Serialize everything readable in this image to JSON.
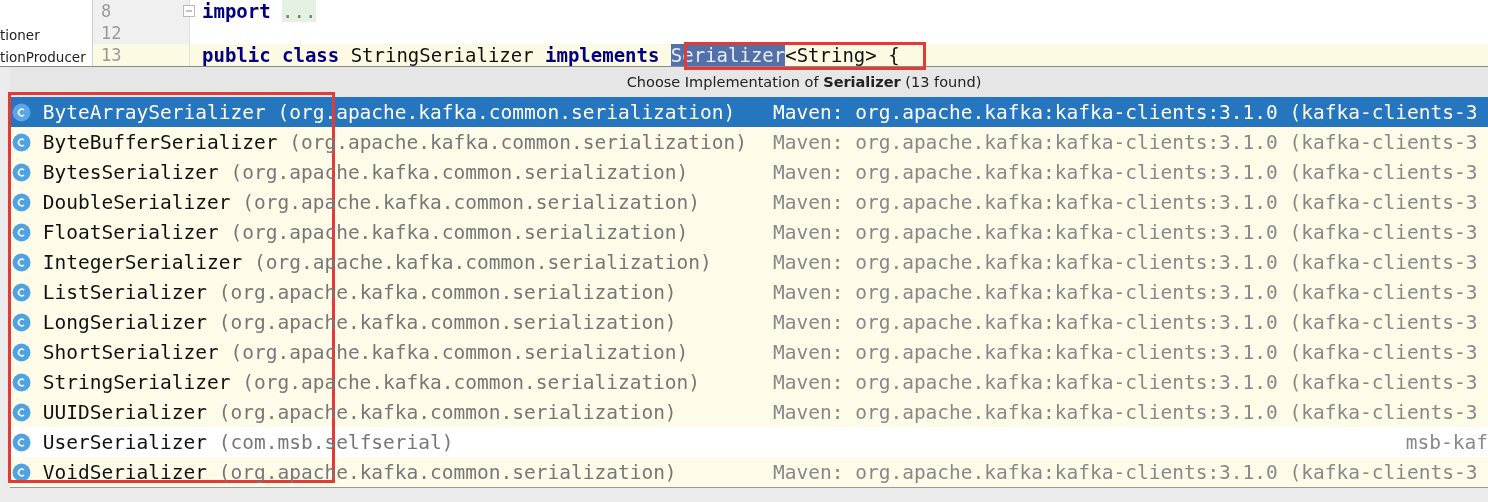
{
  "project_panel": {
    "items": [
      "tioner",
      "tionProducer"
    ]
  },
  "editor": {
    "lines": [
      {
        "number": "8",
        "current": false,
        "foldable": true,
        "tokens": [
          {
            "text": "import",
            "kind": "keyword"
          },
          {
            "text": "...",
            "kind": "folded"
          }
        ]
      },
      {
        "number": "12",
        "current": false,
        "foldable": false
      },
      {
        "number": "13",
        "current": true,
        "foldable": false,
        "tokens": [
          {
            "text": "public",
            "kind": "keyword"
          },
          {
            "text": "class",
            "kind": "keyword"
          },
          {
            "text": "StringSerializer",
            "kind": "plain"
          },
          {
            "text": "implements",
            "kind": "keyword"
          },
          {
            "text": "Serializer",
            "kind": "selected"
          },
          {
            "text": "<String> {",
            "kind": "plain",
            "attached": true
          }
        ]
      }
    ]
  },
  "popup": {
    "title": "Choose Implementation of **Serializer** (13 found)",
    "items": [
      {
        "name": "ByteArraySerializer",
        "package": "(org.apache.kafka.common.serialization)",
        "location": "Maven: org.apache.kafka:kafka-clients:3.1.0 (kafka-clients-3",
        "kind": "library",
        "selected": true
      },
      {
        "name": "ByteBufferSerializer",
        "package": "(org.apache.kafka.common.serialization)",
        "location": "Maven: org.apache.kafka:kafka-clients:3.1.0 (kafka-clients-3",
        "kind": "library",
        "selected": false
      },
      {
        "name": "BytesSerializer",
        "package": "(org.apache.kafka.common.serialization)",
        "location": "Maven: org.apache.kafka:kafka-clients:3.1.0 (kafka-clients-3",
        "kind": "library",
        "selected": false
      },
      {
        "name": "DoubleSerializer",
        "package": "(org.apache.kafka.common.serialization)",
        "location": "Maven: org.apache.kafka:kafka-clients:3.1.0 (kafka-clients-3",
        "kind": "library",
        "selected": false
      },
      {
        "name": "FloatSerializer",
        "package": "(org.apache.kafka.common.serialization)",
        "location": "Maven: org.apache.kafka:kafka-clients:3.1.0 (kafka-clients-3",
        "kind": "library",
        "selected": false
      },
      {
        "name": "IntegerSerializer",
        "package": "(org.apache.kafka.common.serialization)",
        "location": "Maven: org.apache.kafka:kafka-clients:3.1.0 (kafka-clients-3",
        "kind": "library",
        "selected": false
      },
      {
        "name": "ListSerializer",
        "package": "(org.apache.kafka.common.serialization)",
        "location": "Maven: org.apache.kafka:kafka-clients:3.1.0 (kafka-clients-3",
        "kind": "library",
        "selected": false
      },
      {
        "name": "LongSerializer",
        "package": "(org.apache.kafka.common.serialization)",
        "location": "Maven: org.apache.kafka:kafka-clients:3.1.0 (kafka-clients-3",
        "kind": "library",
        "selected": false
      },
      {
        "name": "ShortSerializer",
        "package": "(org.apache.kafka.common.serialization)",
        "location": "Maven: org.apache.kafka:kafka-clients:3.1.0 (kafka-clients-3",
        "kind": "library",
        "selected": false
      },
      {
        "name": "StringSerializer",
        "package": "(org.apache.kafka.common.serialization)",
        "location": "Maven: org.apache.kafka:kafka-clients:3.1.0 (kafka-clients-3",
        "kind": "library",
        "selected": false
      },
      {
        "name": "UUIDSerializer",
        "package": "(org.apache.kafka.common.serialization)",
        "location": "Maven: org.apache.kafka:kafka-clients:3.1.0 (kafka-clients-3",
        "kind": "library",
        "selected": false
      },
      {
        "name": "UserSerializer",
        "package": "(com.msb.selfserial)",
        "location": "msb-kaf",
        "kind": "project",
        "selected": false
      },
      {
        "name": "VoidSerializer",
        "package": "(org.apache.kafka.common.serialization)",
        "location": "Maven: org.apache.kafka:kafka-clients:3.1.0 (kafka-clients-3",
        "kind": "library",
        "selected": false
      }
    ]
  }
}
